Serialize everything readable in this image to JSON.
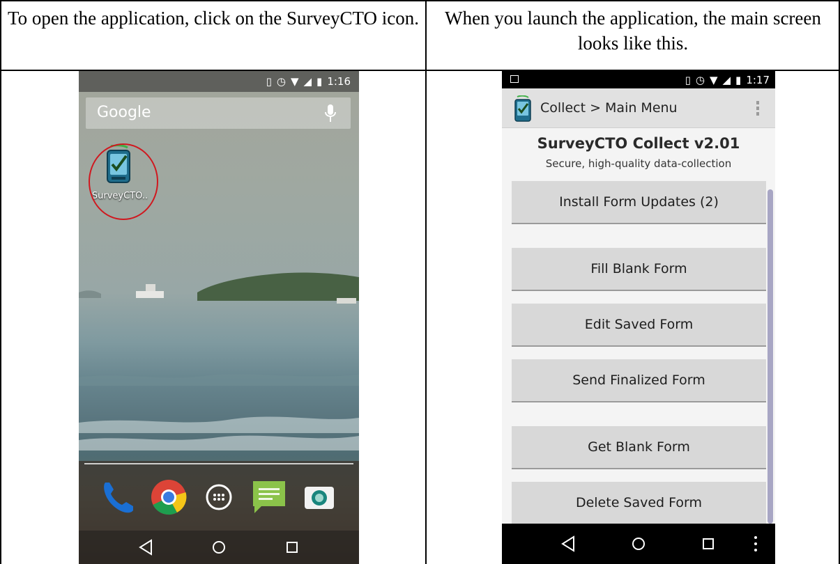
{
  "captions": {
    "left": "To open the application, click on the SurveyCTO icon.",
    "right": "When you launch the application, the main screen looks like this."
  },
  "home_screen": {
    "status_time": "1:16",
    "search_label": "Google",
    "app_label": "SurveyCTO..",
    "highlight_color": "#d0181f",
    "dock_icons": [
      "phone-icon",
      "chrome-icon",
      "app-drawer-icon",
      "messenger-icon",
      "camera-icon"
    ],
    "nav_icons": [
      "back-icon",
      "home-icon",
      "recents-icon"
    ]
  },
  "app_screen": {
    "status_time": "1:17",
    "action_title": "Collect > Main Menu",
    "heading": "SurveyCTO Collect v2.01",
    "subtitle": "Secure, high-quality data-collection",
    "buttons": [
      {
        "label": "Install Form Updates (2)"
      },
      {
        "label": "Fill Blank Form"
      },
      {
        "label": "Edit Saved Form"
      },
      {
        "label": "Send Finalized Form"
      },
      {
        "label": "Get Blank Form"
      },
      {
        "label": "Delete Saved Form"
      }
    ],
    "nav_icons": [
      "back-icon",
      "home-icon",
      "recents-icon",
      "overflow-menu-icon"
    ]
  }
}
